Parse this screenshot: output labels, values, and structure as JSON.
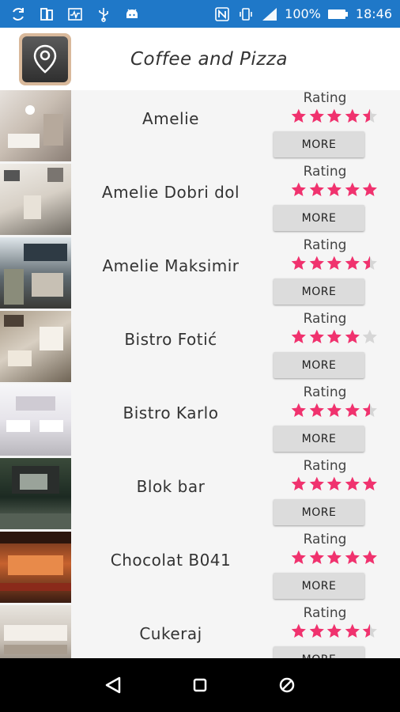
{
  "status": {
    "battery_percent": "100%",
    "time": "18:46"
  },
  "header": {
    "title": "Coffee and Pizza",
    "icon": "location-pin-icon"
  },
  "colors": {
    "status_bar": "#1f78c8",
    "star_filled": "#f0326e",
    "star_empty": "#d6d6d6",
    "button_bg": "#dcdcdc"
  },
  "list": {
    "items": [
      {
        "name": "Amelie",
        "rating_label": "Rating",
        "rating": 4.5,
        "more_label": "MORE"
      },
      {
        "name": "Amelie Dobri dol",
        "rating_label": "Rating",
        "rating": 5,
        "more_label": "MORE"
      },
      {
        "name": "Amelie Maksimir",
        "rating_label": "Rating",
        "rating": 4.5,
        "more_label": "MORE"
      },
      {
        "name": "Bistro Fotić",
        "rating_label": "Rating",
        "rating": 4,
        "more_label": "MORE"
      },
      {
        "name": "Bistro Karlo",
        "rating_label": "Rating",
        "rating": 4.5,
        "more_label": "MORE"
      },
      {
        "name": "Blok bar",
        "rating_label": "Rating",
        "rating": 5,
        "more_label": "MORE"
      },
      {
        "name": "Chocolat B041",
        "rating_label": "Rating",
        "rating": 5,
        "more_label": "MORE"
      },
      {
        "name": "Cukeraj",
        "rating_label": "Rating",
        "rating": 4.5,
        "more_label": "MORE"
      }
    ]
  },
  "navbar": {
    "back": "back-icon",
    "home": "home-icon",
    "recents": "recents-icon"
  }
}
